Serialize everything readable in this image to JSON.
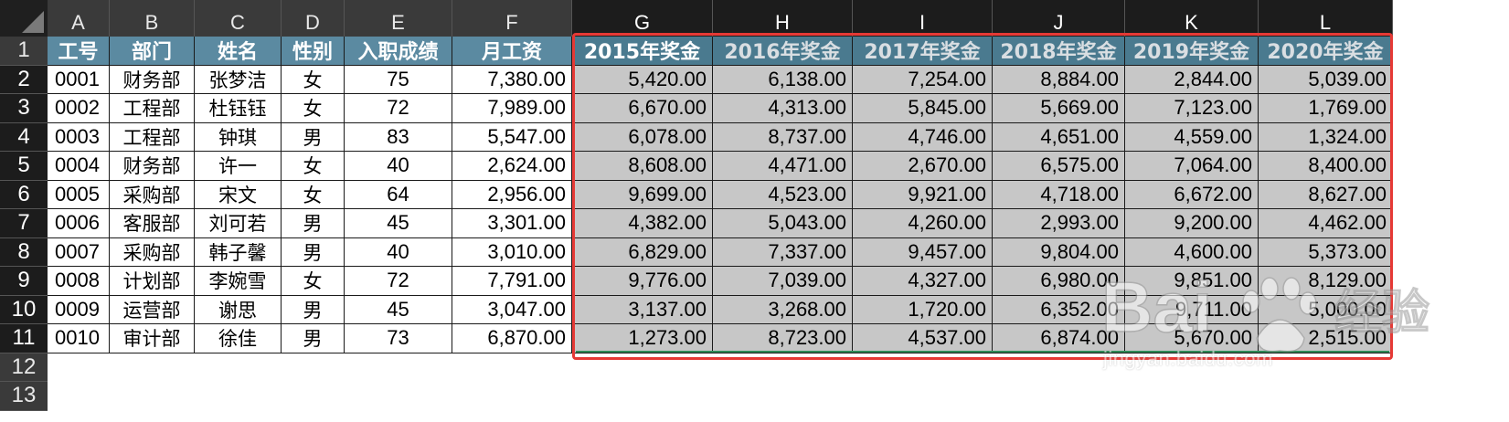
{
  "columns": [
    "A",
    "B",
    "C",
    "D",
    "E",
    "F",
    "G",
    "H",
    "I",
    "J",
    "K",
    "L"
  ],
  "rows": [
    "1",
    "2",
    "3",
    "4",
    "5",
    "6",
    "7",
    "8",
    "9",
    "10",
    "11",
    "12",
    "13"
  ],
  "headers": [
    "工号",
    "部门",
    "姓名",
    "性别",
    "入职成绩",
    "月工资",
    "2015年奖金",
    "2016年奖金",
    "2017年奖金",
    "2018年奖金",
    "2019年奖金",
    "2020年奖金"
  ],
  "data": [
    [
      "0001",
      "财务部",
      "张梦洁",
      "女",
      "75",
      "7,380.00",
      "5,420.00",
      "6,138.00",
      "7,254.00",
      "8,884.00",
      "2,844.00",
      "5,039.00"
    ],
    [
      "0002",
      "工程部",
      "杜钰钰",
      "女",
      "72",
      "7,989.00",
      "6,670.00",
      "4,313.00",
      "5,845.00",
      "5,669.00",
      "7,123.00",
      "1,769.00"
    ],
    [
      "0003",
      "工程部",
      "钟琪",
      "男",
      "83",
      "5,547.00",
      "6,078.00",
      "8,737.00",
      "4,746.00",
      "4,651.00",
      "4,559.00",
      "1,324.00"
    ],
    [
      "0004",
      "财务部",
      "许一",
      "女",
      "40",
      "2,624.00",
      "8,608.00",
      "4,471.00",
      "2,670.00",
      "6,575.00",
      "7,064.00",
      "8,400.00"
    ],
    [
      "0005",
      "采购部",
      "宋文",
      "女",
      "64",
      "2,956.00",
      "9,699.00",
      "4,523.00",
      "9,921.00",
      "4,718.00",
      "6,672.00",
      "8,627.00"
    ],
    [
      "0006",
      "客服部",
      "刘可若",
      "男",
      "45",
      "3,301.00",
      "4,382.00",
      "5,043.00",
      "4,260.00",
      "2,993.00",
      "9,200.00",
      "4,462.00"
    ],
    [
      "0007",
      "采购部",
      "韩子馨",
      "男",
      "40",
      "3,010.00",
      "6,829.00",
      "7,337.00",
      "9,457.00",
      "9,804.00",
      "4,600.00",
      "5,373.00"
    ],
    [
      "0008",
      "计划部",
      "李婉雪",
      "女",
      "72",
      "7,791.00",
      "9,776.00",
      "7,039.00",
      "4,327.00",
      "6,980.00",
      "9,851.00",
      "8,129.00"
    ],
    [
      "0009",
      "运营部",
      "谢思",
      "男",
      "45",
      "3,047.00",
      "3,137.00",
      "3,268.00",
      "1,720.00",
      "6,352.00",
      "9,711.00",
      "5,000.00"
    ],
    [
      "0010",
      "审计部",
      "徐佳",
      "男",
      "73",
      "6,870.00",
      "1,273.00",
      "8,723.00",
      "4,537.00",
      "6,874.00",
      "5,670.00",
      "2,515.00"
    ]
  ],
  "watermark": {
    "logo_text": "Bai",
    "logo_suffix": "经验",
    "url": "jingyan.baidu.com"
  },
  "colors": {
    "header_bg": "#5b8aa1",
    "selected_fill": "#c7c7c7",
    "selection_outline": "#e53935"
  }
}
